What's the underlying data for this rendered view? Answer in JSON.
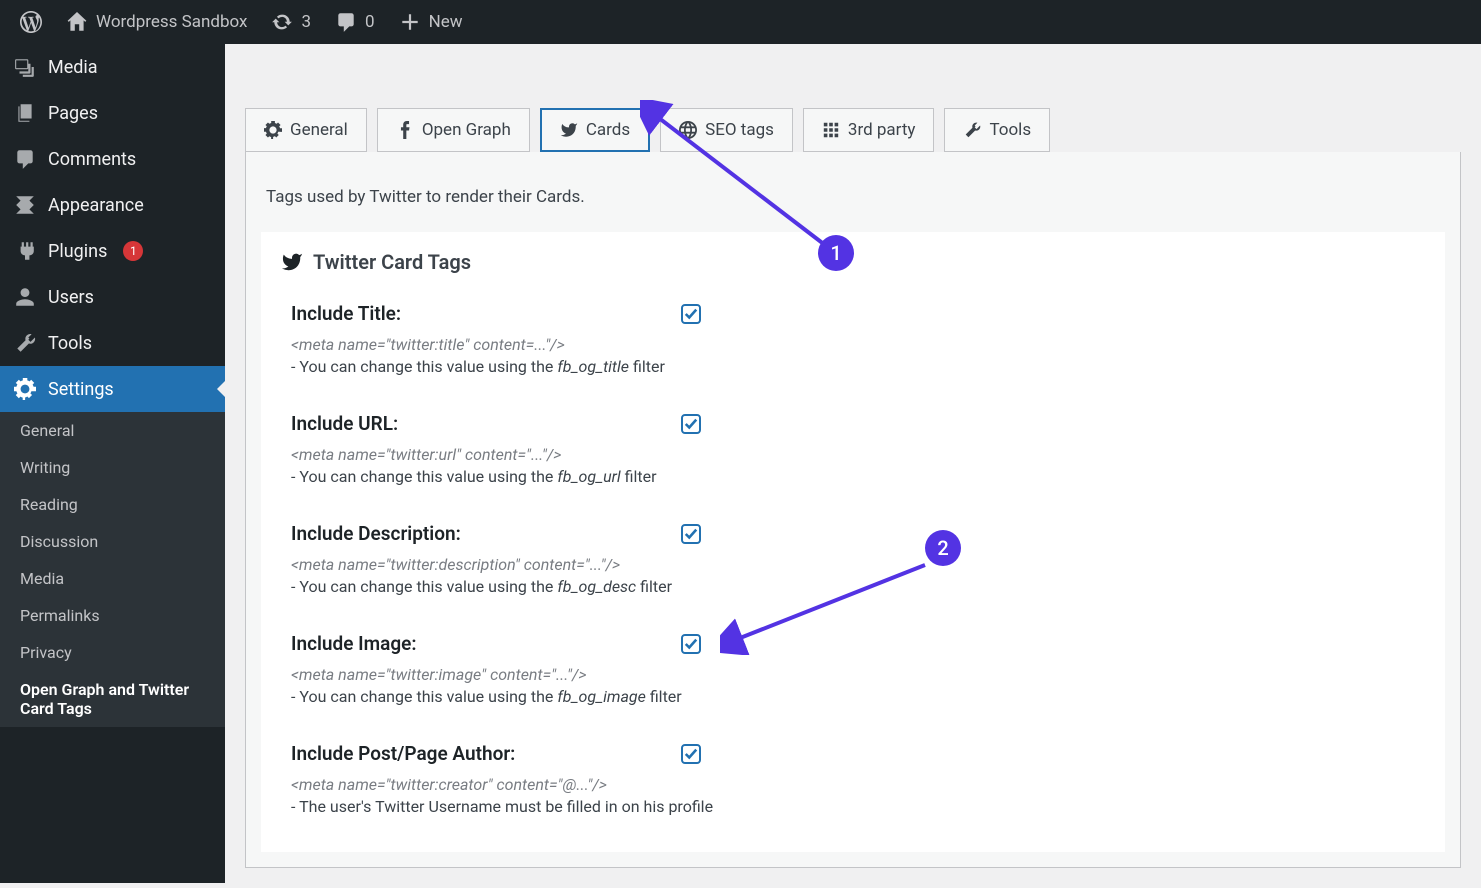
{
  "adminbar": {
    "site_name": "Wordpress Sandbox",
    "updates": "3",
    "comments": "0",
    "new": "New"
  },
  "sidebar": {
    "media": "Media",
    "pages": "Pages",
    "comments": "Comments",
    "appearance": "Appearance",
    "plugins": "Plugins",
    "plugins_badge": "1",
    "users": "Users",
    "tools": "Tools",
    "settings": "Settings",
    "submenu": {
      "general": "General",
      "writing": "Writing",
      "reading": "Reading",
      "discussion": "Discussion",
      "media": "Media",
      "permalinks": "Permalinks",
      "privacy": "Privacy",
      "ogtc": "Open Graph and Twitter Card Tags"
    }
  },
  "tabs": {
    "general": "General",
    "opengraph": "Open Graph",
    "cards": "Cards",
    "seo": "SEO tags",
    "thirdparty": "3rd party",
    "tools": "Tools"
  },
  "panel": {
    "description": "Tags used by Twitter to render their Cards.",
    "section_title": "Twitter Card Tags",
    "fields": {
      "title": {
        "label": "Include Title:",
        "meta": "<meta name=\"twitter:title\" content=...\"/>",
        "help_pre": "- You can change this value using the ",
        "help_filter": "fb_og_title",
        "help_post": " filter"
      },
      "url": {
        "label": "Include URL:",
        "meta": "<meta name=\"twitter:url\" content=\"...\"/>",
        "help_pre": "- You can change this value using the ",
        "help_filter": "fb_og_url",
        "help_post": " filter"
      },
      "description": {
        "label": "Include Description:",
        "meta": "<meta name=\"twitter:description\" content=\"...\"/>",
        "help_pre": "- You can change this value using the ",
        "help_filter": "fb_og_desc",
        "help_post": " filter"
      },
      "image": {
        "label": "Include Image:",
        "meta": "<meta name=\"twitter:image\" content=\"...\"/>",
        "help_pre": "- You can change this value using the ",
        "help_filter": "fb_og_image",
        "help_post": " filter"
      },
      "author": {
        "label": "Include Post/Page Author:",
        "meta": "<meta name=\"twitter:creator\" content=\"@...\"/>",
        "help": "- The user's Twitter Username must be filled in on his profile"
      }
    }
  },
  "annotations": {
    "one": "1",
    "two": "2"
  }
}
